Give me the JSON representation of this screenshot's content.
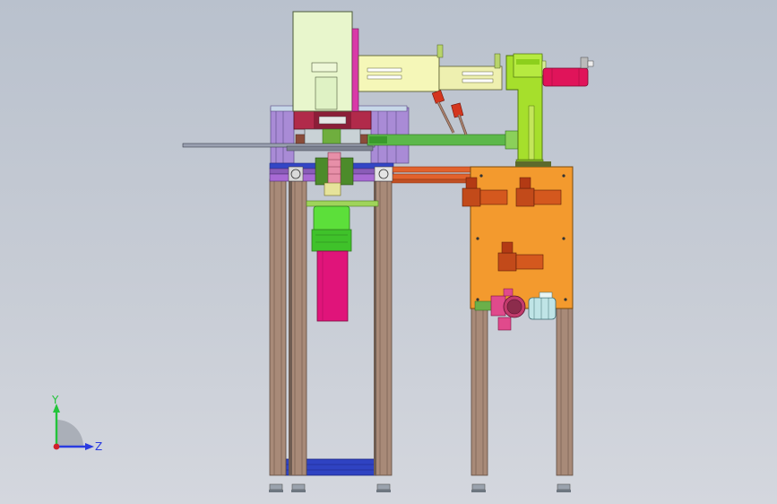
{
  "viewport": {
    "background_top": "#b9c1cd",
    "background_bottom": "#d4d7de"
  },
  "triad": {
    "y_label": "Y",
    "z_label": "Z",
    "y_color": "#22c43a",
    "z_color": "#2a3be0",
    "x_color": "#d0202a"
  },
  "colors": {
    "upright_column": "#a88a78",
    "control_box": "#f39a2e",
    "slide_block": "#e8f6cc",
    "arm": "#f2f4b4",
    "lime": "#a6df2c",
    "magenta": "#e0147a",
    "green_cylinder": "#5cdf3a",
    "blue_frame": "#3346c6",
    "purple_frame": "#9b6fc4",
    "valve_red": "#d4401a",
    "pump": "#c23c6c",
    "motor": "#bfe4e6"
  }
}
